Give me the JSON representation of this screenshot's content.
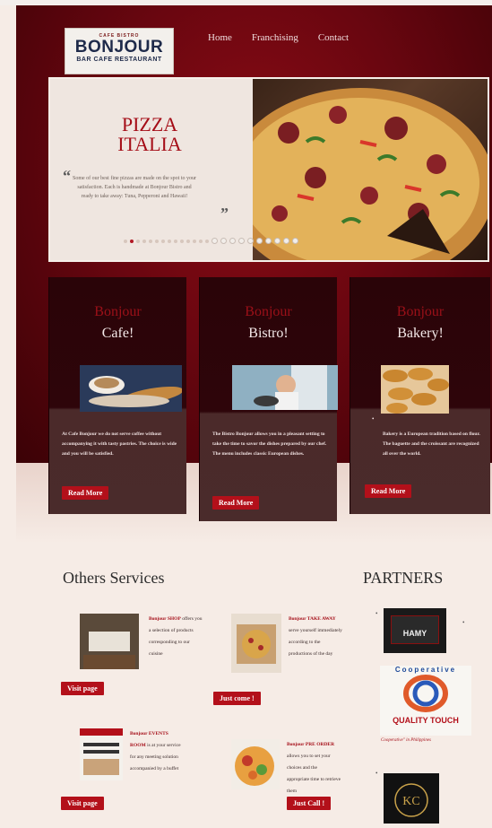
{
  "header": {
    "logo": {
      "top": "CAFE BISTRO",
      "main": "BONJOUR",
      "sub": "BAR CAFE RESTAURANT"
    },
    "nav": [
      "Home",
      "Franchising",
      "Contact"
    ]
  },
  "slider": {
    "title_line1": "PIZZA",
    "title_line2": "ITALIA",
    "quote": "Some of our best fine pizzas are made on the spot to your satisfaction. Each is handmade at Bonjour Bistro and ready to take away: Tuna, Pepperoni and Hawaii!",
    "open_quote": "“",
    "close_quote": "”",
    "dots_total": 24,
    "dots_active_index": 1
  },
  "cards": [
    {
      "title1": "Bonjour",
      "title2": "Cafe!",
      "text": "At Cafe Bonjour we do not serve coffee without accompanying it with tasty pastries. The choice is wide and you will be satisfied.",
      "button": "Read More"
    },
    {
      "title1": "Bonjour",
      "title2": "Bistro!",
      "text": "The Bistro Bonjour allows you in a pleasant setting to take the time to savor the dishes prepared by our chef. The menu includes classic European dishes.",
      "button": "Read More"
    },
    {
      "title1": "Bonjour",
      "title2": "Bakery!",
      "text": "Bakery is a European tradition based on flour. The baguette and the croissant are recognized all over the world.",
      "button": "Read More"
    }
  ],
  "others": {
    "heading": "Others Services",
    "items": [
      {
        "title": "Bonjour SHOP",
        "text": "offers you a selection of products corresponding to our cuisine",
        "button": "Visit page"
      },
      {
        "title": "Bonjour TAKE AWAY",
        "text": "serve yourself immediately according to the productions of the day",
        "button": "Just come !"
      },
      {
        "title": "Bonjour EVENTS ROOM",
        "text": "is at your service for any meeting solution accompanied by a buffet",
        "button": "Visit page"
      },
      {
        "title": "Bonjour PRE ORDER",
        "text": "allows you to set your choices and the appropriate time to retrieve them",
        "button": "Just Call !"
      }
    ]
  },
  "partners": {
    "heading": "PARTNERS",
    "items": [
      {
        "name": "HAMY"
      },
      {
        "name": "QUALITY TOUCH",
        "top": "Cooperative",
        "caption": "Cooperative\" in Philippines"
      },
      {
        "name": "KC"
      }
    ]
  },
  "colors": {
    "brand_red": "#b3101a",
    "hero_dark": "#3b0206",
    "accent_title": "#a50e18"
  }
}
